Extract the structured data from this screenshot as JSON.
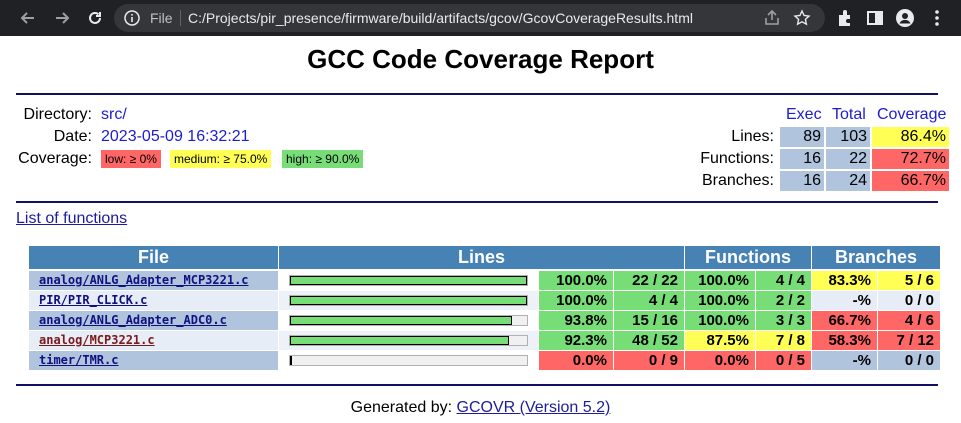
{
  "browser": {
    "file_label": "File",
    "url": "C:/Projects/pir_presence/firmware/build/artifacts/gcov/GcovCoverageResults.html"
  },
  "report": {
    "title": "GCC Code Coverage Report",
    "directory_label": "Directory:",
    "directory_value": "src/",
    "date_label": "Date:",
    "date_value": "2023-05-09 16:32:21",
    "coverage_label": "Coverage:",
    "legend": {
      "low": "low: ≥ 0%",
      "medium": "medium: ≥ 75.0%",
      "high": "high: ≥ 90.0%"
    },
    "summary": {
      "headers": {
        "exec": "Exec",
        "total": "Total",
        "coverage": "Coverage"
      },
      "rows": [
        {
          "label": "Lines:",
          "exec": "89",
          "total": "103",
          "coverage": "86.4%",
          "level": "med"
        },
        {
          "label": "Functions:",
          "exec": "16",
          "total": "22",
          "coverage": "72.7%",
          "level": "low"
        },
        {
          "label": "Branches:",
          "exec": "16",
          "total": "24",
          "coverage": "66.7%",
          "level": "low"
        }
      ]
    },
    "list_of_functions": "List of functions",
    "table_headers": {
      "file": "File",
      "lines": "Lines",
      "functions": "Functions",
      "branches": "Branches"
    },
    "files": [
      {
        "name": "analog/ANLG_Adapter_MCP3221.c",
        "visited": false,
        "line_pct_value": 100.0,
        "line_pct": "100.0%",
        "line_cnt": "22 / 22",
        "line_level": "high",
        "func_pct": "100.0%",
        "func_cnt": "4 / 4",
        "func_level": "high",
        "br_pct": "83.3%",
        "br_cnt": "5 / 6",
        "br_level": "med"
      },
      {
        "name": "PIR/PIR_CLICK.c",
        "visited": false,
        "line_pct_value": 100.0,
        "line_pct": "100.0%",
        "line_cnt": "4 / 4",
        "line_level": "high",
        "func_pct": "100.0%",
        "func_cnt": "2 / 2",
        "func_level": "high",
        "br_pct": "-%",
        "br_cnt": "0 / 0",
        "br_level": "none"
      },
      {
        "name": "analog/ANLG_Adapter_ADC0.c",
        "visited": false,
        "line_pct_value": 93.8,
        "line_pct": "93.8%",
        "line_cnt": "15 / 16",
        "line_level": "high",
        "func_pct": "100.0%",
        "func_cnt": "3 / 3",
        "func_level": "high",
        "br_pct": "66.7%",
        "br_cnt": "4 / 6",
        "br_level": "low"
      },
      {
        "name": "analog/MCP3221.c",
        "visited": true,
        "line_pct_value": 92.3,
        "line_pct": "92.3%",
        "line_cnt": "48 / 52",
        "line_level": "high",
        "func_pct": "87.5%",
        "func_cnt": "7 / 8",
        "func_level": "med",
        "br_pct": "58.3%",
        "br_cnt": "7 / 12",
        "br_level": "low"
      },
      {
        "name": "timer/TMR.c",
        "visited": false,
        "line_pct_value": 0.0,
        "line_pct": "0.0%",
        "line_cnt": "0 / 9",
        "line_level": "low",
        "func_pct": "0.0%",
        "func_cnt": "0 / 5",
        "func_level": "low",
        "br_pct": "-%",
        "br_cnt": "0 / 0",
        "br_level": "none"
      }
    ],
    "footer_prefix": "Generated by: ",
    "footer_link": "GCOVR (Version 5.2)"
  },
  "colors": {
    "high": "#77dd77",
    "medium": "#ffff55",
    "low": "#ff6666",
    "header": "#4682b4",
    "neutral": "#b0c4de"
  }
}
